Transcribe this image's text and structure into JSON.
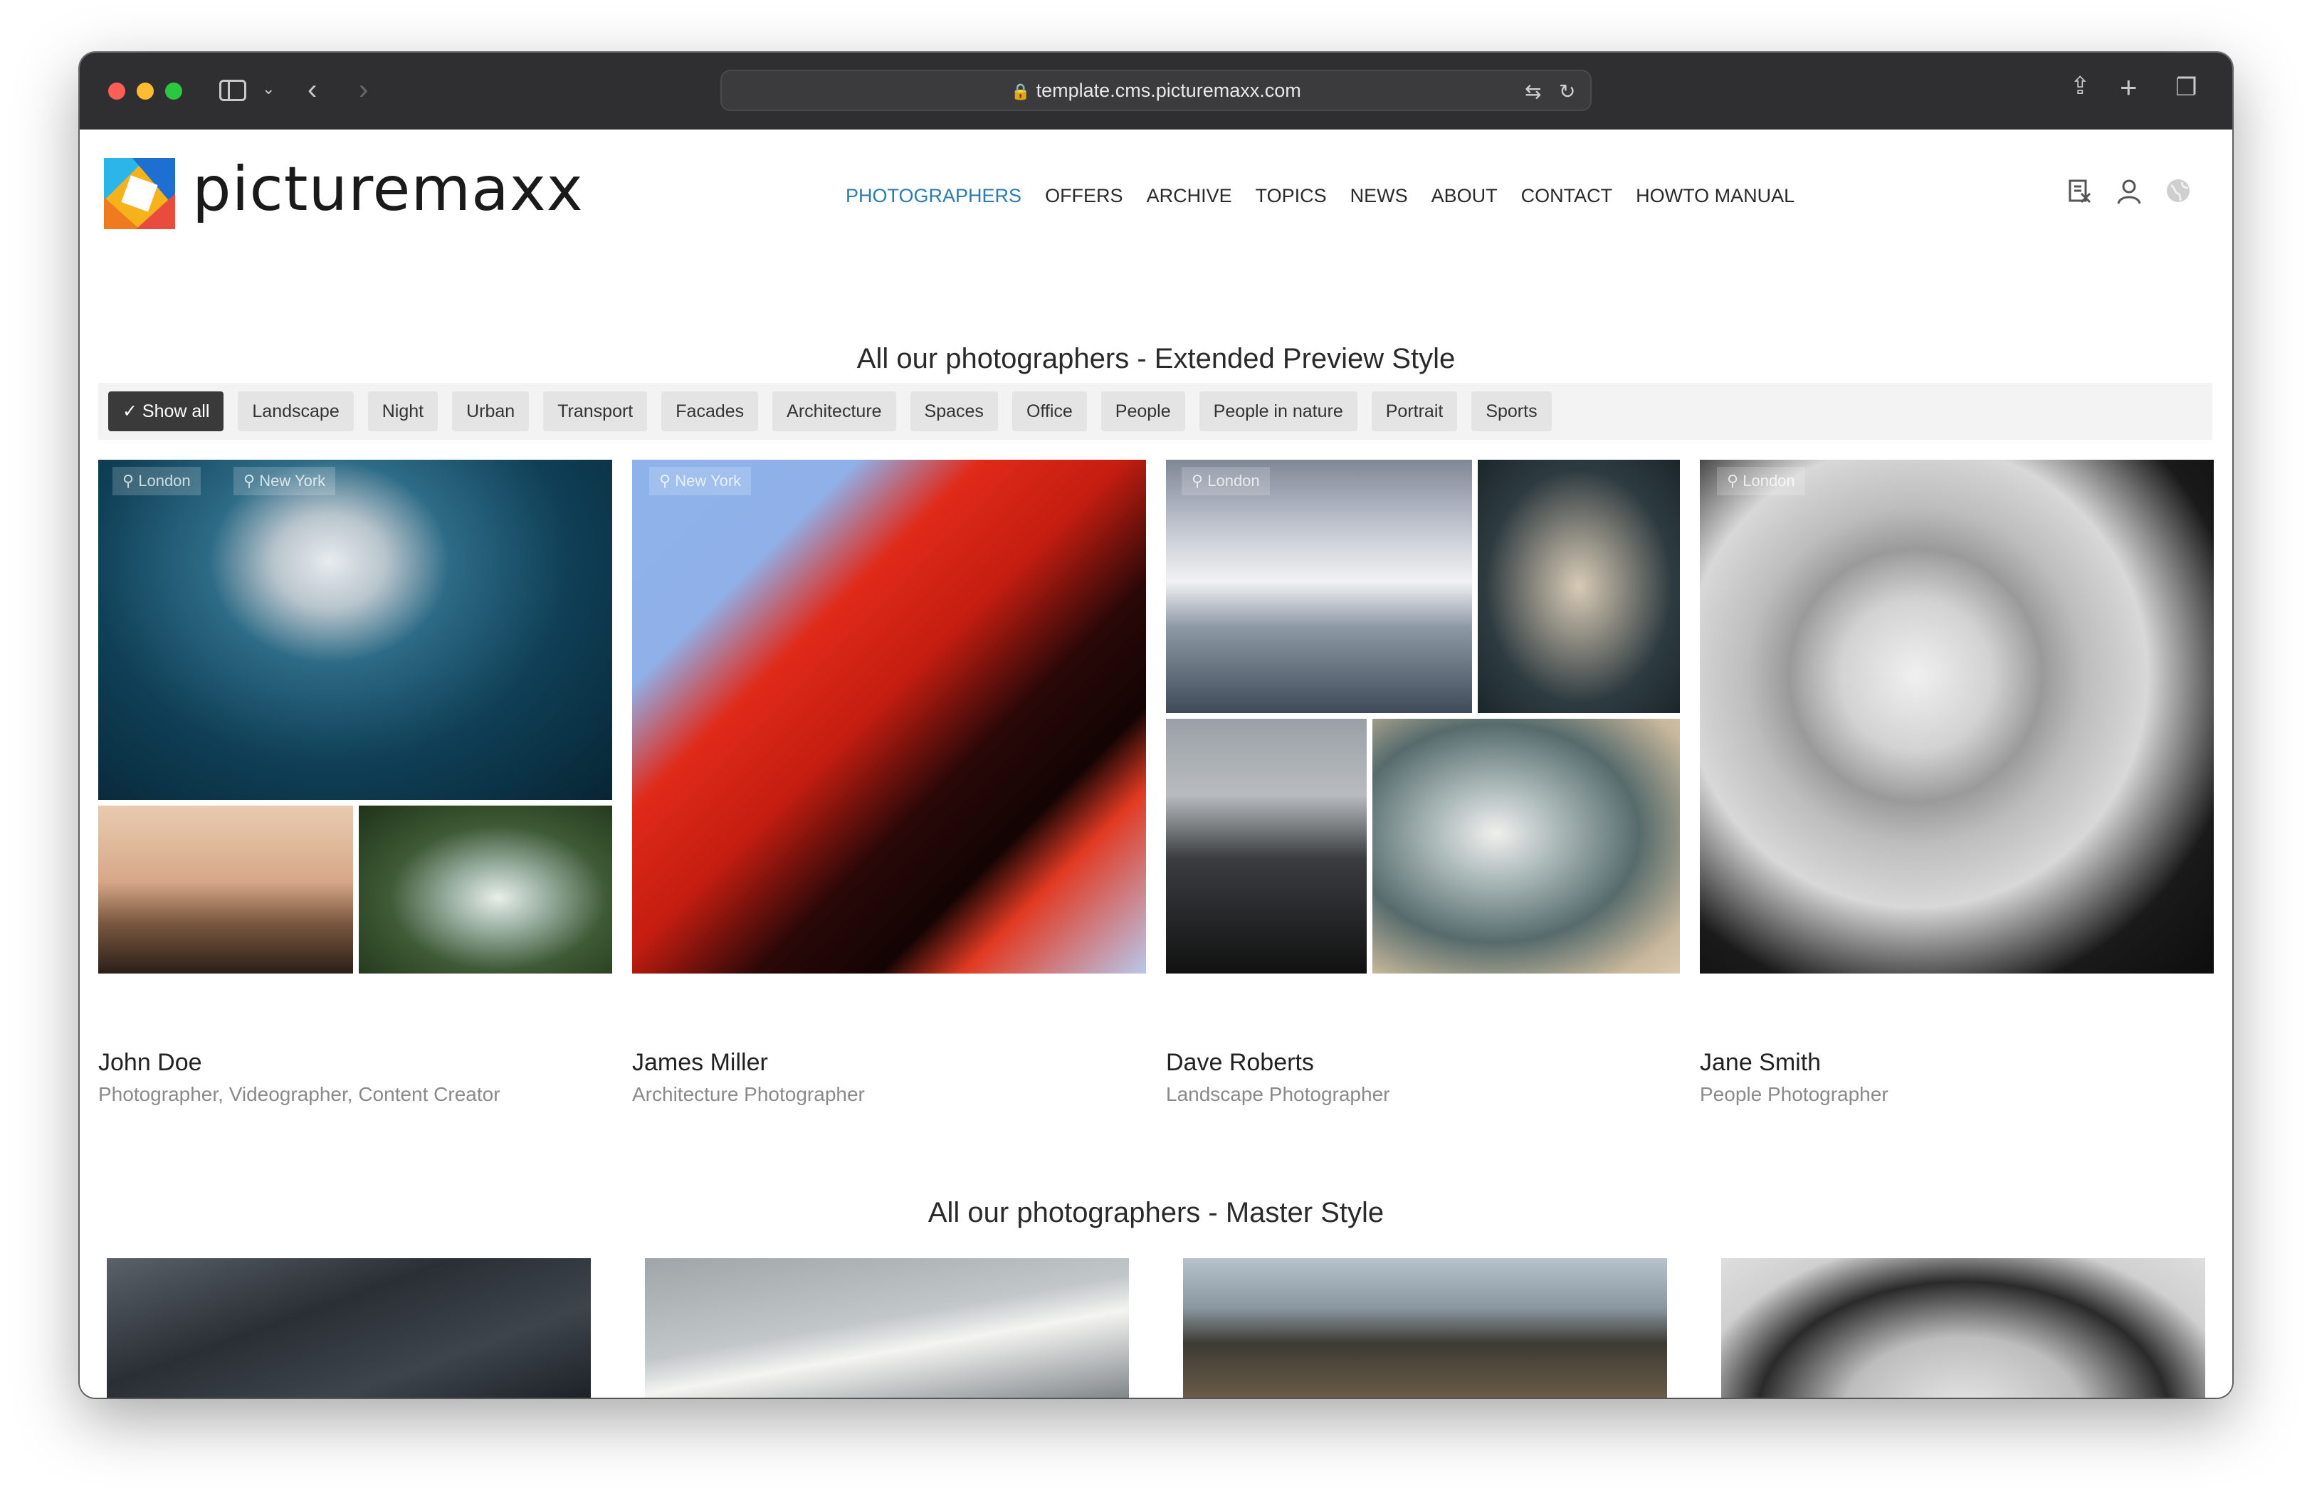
{
  "browser": {
    "url": "template.cms.picturemaxx.com"
  },
  "header": {
    "brand": "picturemaxx",
    "nav": [
      {
        "label": "PHOTOGRAPHERS",
        "active": true
      },
      {
        "label": "OFFERS"
      },
      {
        "label": "ARCHIVE"
      },
      {
        "label": "TOPICS"
      },
      {
        "label": "NEWS"
      },
      {
        "label": "ABOUT"
      },
      {
        "label": "CONTACT"
      },
      {
        "label": "HOWTO MANUAL"
      }
    ],
    "icons": [
      "lightbox-icon",
      "user-icon",
      "globe-icon"
    ]
  },
  "section1": {
    "title": "All our photographers - Extended Preview Style",
    "filters": [
      {
        "label": "Show all",
        "active": true
      },
      {
        "label": "Landscape"
      },
      {
        "label": "Night"
      },
      {
        "label": "Urban"
      },
      {
        "label": "Transport"
      },
      {
        "label": "Facades"
      },
      {
        "label": "Architecture"
      },
      {
        "label": "Spaces"
      },
      {
        "label": "Office"
      },
      {
        "label": "People"
      },
      {
        "label": "People in nature"
      },
      {
        "label": "Portrait"
      },
      {
        "label": "Sports"
      }
    ],
    "photographers": [
      {
        "name": "John Doe",
        "role": "Photographer, Videographer, Content Creator",
        "locations": [
          "London",
          "New York"
        ]
      },
      {
        "name": "James Miller",
        "role": "Architecture Photographer",
        "locations": [
          "New York"
        ]
      },
      {
        "name": "Dave Roberts",
        "role": "Landscape Photographer",
        "locations": [
          "London"
        ]
      },
      {
        "name": "Jane Smith",
        "role": "People Photographer",
        "locations": [
          "London"
        ]
      }
    ]
  },
  "section2": {
    "title": "All our photographers - Master Style"
  },
  "colors": {
    "accent": "#2a7bb0",
    "titlebar": "#2f2f31",
    "chip_active": "#3a3a3a"
  }
}
